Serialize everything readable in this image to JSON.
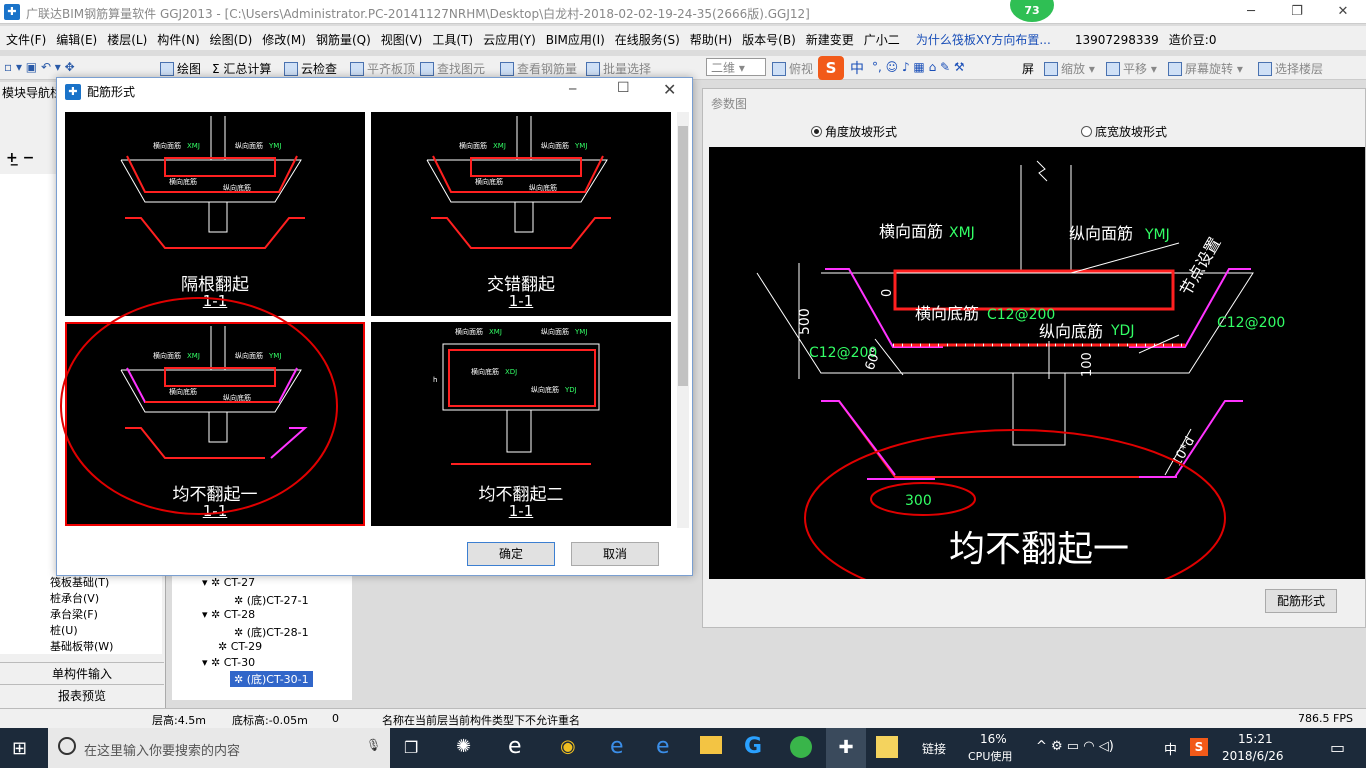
{
  "window": {
    "title": "广联达BIM钢筋算量软件 GGJ2013 - [C:\\Users\\Administrator.PC-20141127NRHM\\Desktop\\白龙村-2018-02-02-19-24-35(2666版).GGJ12]",
    "min": "─",
    "max": "❐",
    "close": "✕"
  },
  "badge": "73",
  "menu": [
    "文件(F)",
    "编辑(E)",
    "楼层(L)",
    "构件(N)",
    "绘图(D)",
    "修改(M)",
    "钢筋量(Q)",
    "视图(V)",
    "工具(T)",
    "云应用(Y)",
    "BIM应用(I)",
    "在线服务(S)",
    "帮助(H)",
    "版本号(B)",
    "新建变更",
    "广小二",
    "为什么筏板XY方向布置...",
    "13907298339",
    "造价豆:0"
  ],
  "toolbar": {
    "draw": "绘图",
    "sum": "汇总计算",
    "cloud_check": "云检查",
    "flat_top": "平齐板顶",
    "find": "查找图元",
    "view_rebar": "查看钢筋量",
    "batch": "批量选择",
    "view2d": "二维",
    "top_view": "俯视",
    "zoom": "缩放",
    "pan": "平移",
    "rotate": "屏幕旋转",
    "select_floor": "选择楼层",
    "zhong": "中",
    "screen": "屏"
  },
  "left_panel": {
    "title": "模块导航栏",
    "items": [
      "筏板基础(T)",
      "桩承台(V)",
      "承台梁(F)",
      "桩(U)",
      "基础板带(W)"
    ],
    "single_input": "单构件输入",
    "report_preview": "报表预览"
  },
  "tree": {
    "items": [
      "CT-27",
      "(底)CT-27-1",
      "CT-28",
      "(底)CT-28-1",
      "CT-29",
      "CT-30",
      "(底)CT-30-1"
    ]
  },
  "dialog": {
    "title": "配筋形式",
    "ok": "确定",
    "cancel": "取消",
    "options": [
      {
        "caption": "隔根翻起",
        "section": "1-1"
      },
      {
        "caption": "交错翻起",
        "section": "1-1"
      },
      {
        "caption": "均不翻起一",
        "section": "1-1"
      },
      {
        "caption": "均不翻起二",
        "section": "1-1"
      }
    ],
    "thumb_labels": {
      "hmj": "横向面筋",
      "xmj": "XMJ",
      "zmj": "纵向面筋",
      "ymj": "YMJ",
      "hdj": "横向底筋",
      "xdj": "XDJ",
      "zdj": "纵向底筋",
      "ydj": "YDJ",
      "h": "h",
      "jdsz": "节点设置"
    }
  },
  "param": {
    "title": "参数图",
    "radio1": "角度放坡形式",
    "radio2": "底宽放坡形式",
    "hmj": "横向面筋",
    "xmj": "XMJ",
    "zmj": "纵向面筋",
    "ymj": "YMJ",
    "hdj": "横向底筋",
    "c12": "C12@200",
    "zdj": "纵向底筋",
    "ydj": "YDJ",
    "jdsz": "节点设置",
    "c12b": "C12@200",
    "c12c": "C12@200",
    "d500": "500",
    "d0": "0",
    "d60": "60°",
    "d100": "100",
    "d10d": "10*d",
    "d300": "300",
    "caption": "均不翻起一",
    "btn": "配筋形式"
  },
  "status": {
    "floor_h": "层高:4.5m",
    "base_h": "底标高:-0.05m",
    "zero": "0",
    "msg": "名称在当前层当前构件类型下不允许重名",
    "fps": "786.5 FPS"
  },
  "taskbar": {
    "search": "在这里输入你要搜索的内容",
    "link": "链接",
    "cpu": "16%",
    "cpu_label": "CPU使用",
    "ime": "中",
    "time": "15:21",
    "date": "2018/6/26"
  },
  "colors": {
    "cad_bg": "#000000",
    "rebar_red": "#ff0000",
    "magenta": "#e040e0",
    "label_green": "#33ff66",
    "annotation_red": "#e00000"
  }
}
